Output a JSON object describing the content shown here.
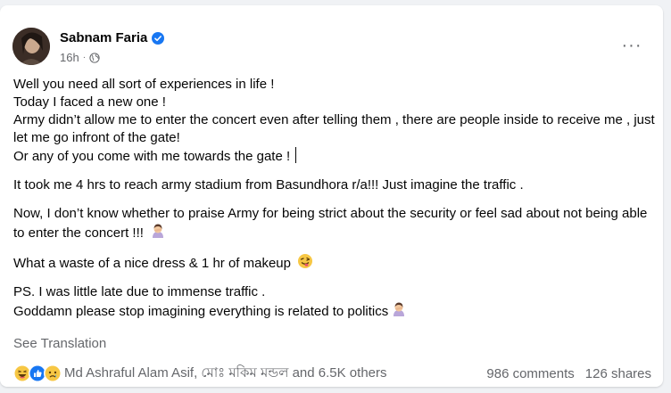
{
  "post": {
    "author": "Sabnam Faria",
    "time": "16h",
    "separator": "·",
    "more_icon": "···",
    "paragraphs": [
      {
        "lines": [
          "Well you need all sort of experiences in life !",
          "Today I faced a new one !",
          "Army didn’t allow me to enter the concert even after telling them , there are people inside to receive me , just let me go infront of the gate!",
          "Or any of you come with me towards the gate !"
        ]
      },
      {
        "lines": [
          "It took me 4 hrs to reach army stadium from Basundhora r/a!!! Just imagine the traffic ."
        ]
      },
      {
        "lines": [
          "Now, I don’t know whether to praise Army for being strict about the security or feel sad about not being able to enter the concert !!!"
        ]
      },
      {
        "lines": [
          "What a waste of a nice dress & 1 hr of makeup"
        ]
      },
      {
        "lines": [
          "PS. I was little late due to immense traffic .",
          "Goddamn please stop imagining everything is related to politics"
        ]
      }
    ],
    "see_translation": "See Translation",
    "reactions_text": "Md Ashraful Alam Asif, মোঃ মকিম মন্ডল and 6.5K others",
    "comments": "986 comments",
    "shares": "126 shares"
  },
  "icons": {
    "verified": "verified-badge-icon",
    "globe": "globe-icon",
    "reactions": [
      "haha-reaction-icon",
      "like-reaction-icon",
      "sad-reaction-icon"
    ],
    "facepalm": "woman-facepalming-emoji",
    "wink": "winking-tongue-emoji"
  },
  "colors": {
    "brand_blue": "#1877f2",
    "secondary_text": "#65676b",
    "primary_text": "#050505"
  }
}
